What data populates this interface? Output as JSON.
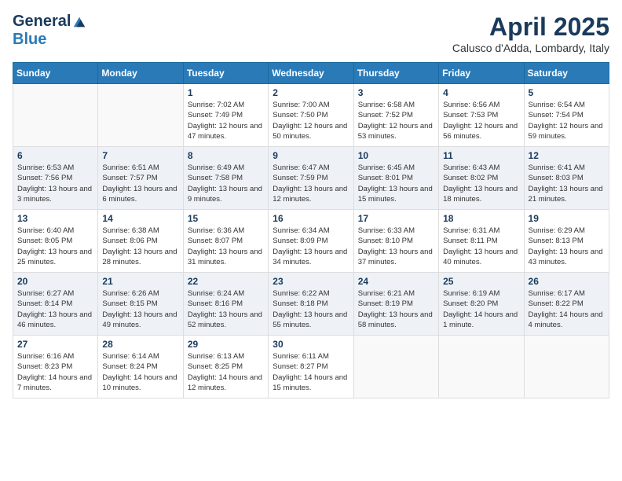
{
  "header": {
    "logo_general": "General",
    "logo_blue": "Blue",
    "month_title": "April 2025",
    "location": "Calusco d'Adda, Lombardy, Italy"
  },
  "days_of_week": [
    "Sunday",
    "Monday",
    "Tuesday",
    "Wednesday",
    "Thursday",
    "Friday",
    "Saturday"
  ],
  "weeks": [
    [
      {
        "day": "",
        "sunrise": "",
        "sunset": "",
        "daylight": ""
      },
      {
        "day": "",
        "sunrise": "",
        "sunset": "",
        "daylight": ""
      },
      {
        "day": "1",
        "sunrise": "Sunrise: 7:02 AM",
        "sunset": "Sunset: 7:49 PM",
        "daylight": "Daylight: 12 hours and 47 minutes."
      },
      {
        "day": "2",
        "sunrise": "Sunrise: 7:00 AM",
        "sunset": "Sunset: 7:50 PM",
        "daylight": "Daylight: 12 hours and 50 minutes."
      },
      {
        "day": "3",
        "sunrise": "Sunrise: 6:58 AM",
        "sunset": "Sunset: 7:52 PM",
        "daylight": "Daylight: 12 hours and 53 minutes."
      },
      {
        "day": "4",
        "sunrise": "Sunrise: 6:56 AM",
        "sunset": "Sunset: 7:53 PM",
        "daylight": "Daylight: 12 hours and 56 minutes."
      },
      {
        "day": "5",
        "sunrise": "Sunrise: 6:54 AM",
        "sunset": "Sunset: 7:54 PM",
        "daylight": "Daylight: 12 hours and 59 minutes."
      }
    ],
    [
      {
        "day": "6",
        "sunrise": "Sunrise: 6:53 AM",
        "sunset": "Sunset: 7:56 PM",
        "daylight": "Daylight: 13 hours and 3 minutes."
      },
      {
        "day": "7",
        "sunrise": "Sunrise: 6:51 AM",
        "sunset": "Sunset: 7:57 PM",
        "daylight": "Daylight: 13 hours and 6 minutes."
      },
      {
        "day": "8",
        "sunrise": "Sunrise: 6:49 AM",
        "sunset": "Sunset: 7:58 PM",
        "daylight": "Daylight: 13 hours and 9 minutes."
      },
      {
        "day": "9",
        "sunrise": "Sunrise: 6:47 AM",
        "sunset": "Sunset: 7:59 PM",
        "daylight": "Daylight: 13 hours and 12 minutes."
      },
      {
        "day": "10",
        "sunrise": "Sunrise: 6:45 AM",
        "sunset": "Sunset: 8:01 PM",
        "daylight": "Daylight: 13 hours and 15 minutes."
      },
      {
        "day": "11",
        "sunrise": "Sunrise: 6:43 AM",
        "sunset": "Sunset: 8:02 PM",
        "daylight": "Daylight: 13 hours and 18 minutes."
      },
      {
        "day": "12",
        "sunrise": "Sunrise: 6:41 AM",
        "sunset": "Sunset: 8:03 PM",
        "daylight": "Daylight: 13 hours and 21 minutes."
      }
    ],
    [
      {
        "day": "13",
        "sunrise": "Sunrise: 6:40 AM",
        "sunset": "Sunset: 8:05 PM",
        "daylight": "Daylight: 13 hours and 25 minutes."
      },
      {
        "day": "14",
        "sunrise": "Sunrise: 6:38 AM",
        "sunset": "Sunset: 8:06 PM",
        "daylight": "Daylight: 13 hours and 28 minutes."
      },
      {
        "day": "15",
        "sunrise": "Sunrise: 6:36 AM",
        "sunset": "Sunset: 8:07 PM",
        "daylight": "Daylight: 13 hours and 31 minutes."
      },
      {
        "day": "16",
        "sunrise": "Sunrise: 6:34 AM",
        "sunset": "Sunset: 8:09 PM",
        "daylight": "Daylight: 13 hours and 34 minutes."
      },
      {
        "day": "17",
        "sunrise": "Sunrise: 6:33 AM",
        "sunset": "Sunset: 8:10 PM",
        "daylight": "Daylight: 13 hours and 37 minutes."
      },
      {
        "day": "18",
        "sunrise": "Sunrise: 6:31 AM",
        "sunset": "Sunset: 8:11 PM",
        "daylight": "Daylight: 13 hours and 40 minutes."
      },
      {
        "day": "19",
        "sunrise": "Sunrise: 6:29 AM",
        "sunset": "Sunset: 8:13 PM",
        "daylight": "Daylight: 13 hours and 43 minutes."
      }
    ],
    [
      {
        "day": "20",
        "sunrise": "Sunrise: 6:27 AM",
        "sunset": "Sunset: 8:14 PM",
        "daylight": "Daylight: 13 hours and 46 minutes."
      },
      {
        "day": "21",
        "sunrise": "Sunrise: 6:26 AM",
        "sunset": "Sunset: 8:15 PM",
        "daylight": "Daylight: 13 hours and 49 minutes."
      },
      {
        "day": "22",
        "sunrise": "Sunrise: 6:24 AM",
        "sunset": "Sunset: 8:16 PM",
        "daylight": "Daylight: 13 hours and 52 minutes."
      },
      {
        "day": "23",
        "sunrise": "Sunrise: 6:22 AM",
        "sunset": "Sunset: 8:18 PM",
        "daylight": "Daylight: 13 hours and 55 minutes."
      },
      {
        "day": "24",
        "sunrise": "Sunrise: 6:21 AM",
        "sunset": "Sunset: 8:19 PM",
        "daylight": "Daylight: 13 hours and 58 minutes."
      },
      {
        "day": "25",
        "sunrise": "Sunrise: 6:19 AM",
        "sunset": "Sunset: 8:20 PM",
        "daylight": "Daylight: 14 hours and 1 minute."
      },
      {
        "day": "26",
        "sunrise": "Sunrise: 6:17 AM",
        "sunset": "Sunset: 8:22 PM",
        "daylight": "Daylight: 14 hours and 4 minutes."
      }
    ],
    [
      {
        "day": "27",
        "sunrise": "Sunrise: 6:16 AM",
        "sunset": "Sunset: 8:23 PM",
        "daylight": "Daylight: 14 hours and 7 minutes."
      },
      {
        "day": "28",
        "sunrise": "Sunrise: 6:14 AM",
        "sunset": "Sunset: 8:24 PM",
        "daylight": "Daylight: 14 hours and 10 minutes."
      },
      {
        "day": "29",
        "sunrise": "Sunrise: 6:13 AM",
        "sunset": "Sunset: 8:25 PM",
        "daylight": "Daylight: 14 hours and 12 minutes."
      },
      {
        "day": "30",
        "sunrise": "Sunrise: 6:11 AM",
        "sunset": "Sunset: 8:27 PM",
        "daylight": "Daylight: 14 hours and 15 minutes."
      },
      {
        "day": "",
        "sunrise": "",
        "sunset": "",
        "daylight": ""
      },
      {
        "day": "",
        "sunrise": "",
        "sunset": "",
        "daylight": ""
      },
      {
        "day": "",
        "sunrise": "",
        "sunset": "",
        "daylight": ""
      }
    ]
  ]
}
